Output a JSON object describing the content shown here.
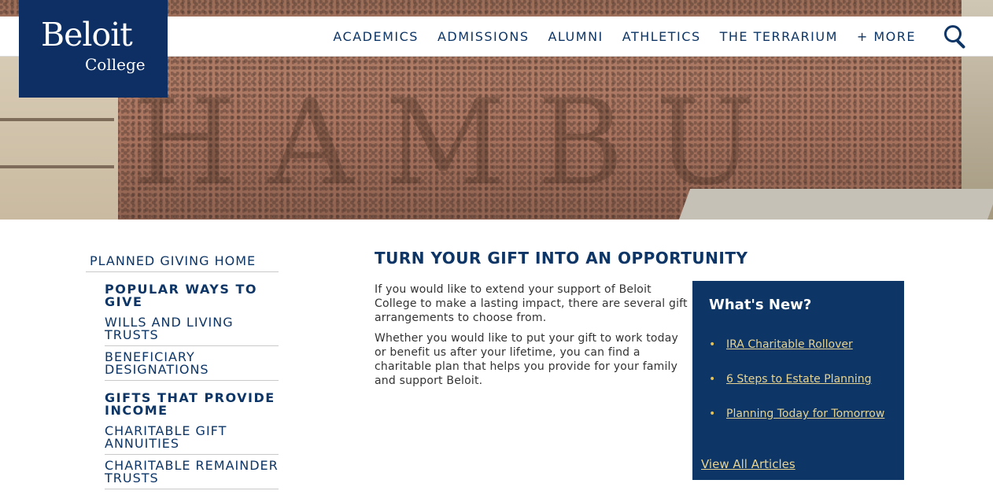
{
  "logo": {
    "line1": "Beloit",
    "line2": "College"
  },
  "nav": {
    "items": [
      "ACADEMICS",
      "ADMISSIONS",
      "ALUMNI",
      "ATHLETICS",
      "THE TERRARIUM",
      "+ MORE"
    ],
    "search_icon": "search-icon"
  },
  "hero": {
    "carved_text": "HAMBU"
  },
  "sidebar": {
    "home": "PLANNED GIVING HOME",
    "groups": [
      {
        "heading": "POPULAR WAYS TO GIVE",
        "items": [
          "WILLS AND LIVING TRUSTS",
          "BENEFICIARY DESIGNATIONS"
        ]
      },
      {
        "heading": "GIFTS THAT PROVIDE INCOME",
        "items": [
          "CHARITABLE GIFT ANNUITIES",
          "CHARITABLE REMAINDER TRUSTS"
        ]
      }
    ]
  },
  "main": {
    "title": "TURN YOUR GIFT INTO AN OPPORTUNITY",
    "paragraphs": [
      "If you would like to extend your support of Beloit College to make a lasting impact, there are several gift arrangements to choose from.",
      "Whether you would like to put your gift to work today or benefit us after your lifetime, you can find a charitable plan that helps you provide for your family and support Beloit."
    ]
  },
  "news": {
    "title": "What's New?",
    "items": [
      "IRA Charitable Rollover",
      "6 Steps to Estate Planning",
      "Planning Today for Tomorrow"
    ],
    "view_all": "View All Articles"
  },
  "colors": {
    "brand_navy": "#0d3566",
    "accent_gold": "#e8d48f"
  }
}
